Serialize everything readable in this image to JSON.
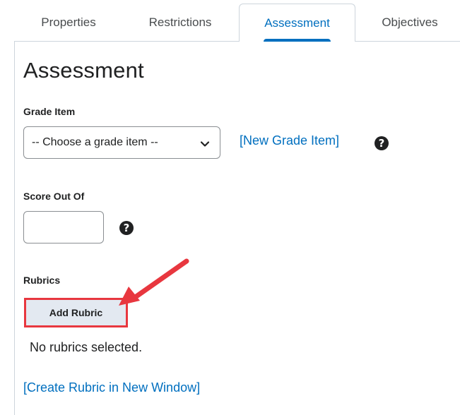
{
  "tabs": [
    {
      "label": "Properties"
    },
    {
      "label": "Restrictions"
    },
    {
      "label": "Assessment"
    },
    {
      "label": "Objectives"
    }
  ],
  "page_title": "Assessment",
  "grade_item": {
    "label": "Grade Item",
    "selected": "-- Choose a grade item --",
    "new_link": "[New Grade Item]",
    "help_glyph": "?"
  },
  "score": {
    "label": "Score Out Of",
    "value": "",
    "help_glyph": "?"
  },
  "rubrics": {
    "label": "Rubrics",
    "add_button": "Add Rubric",
    "empty_text": "No rubrics selected.",
    "create_link": "[Create Rubric in New Window]"
  },
  "colors": {
    "accent": "#006fbf",
    "highlight": "#e8373f"
  },
  "icons": {
    "dropdown": "chevron-down-icon",
    "help": "question-circle-icon",
    "annotation": "arrow-icon"
  }
}
